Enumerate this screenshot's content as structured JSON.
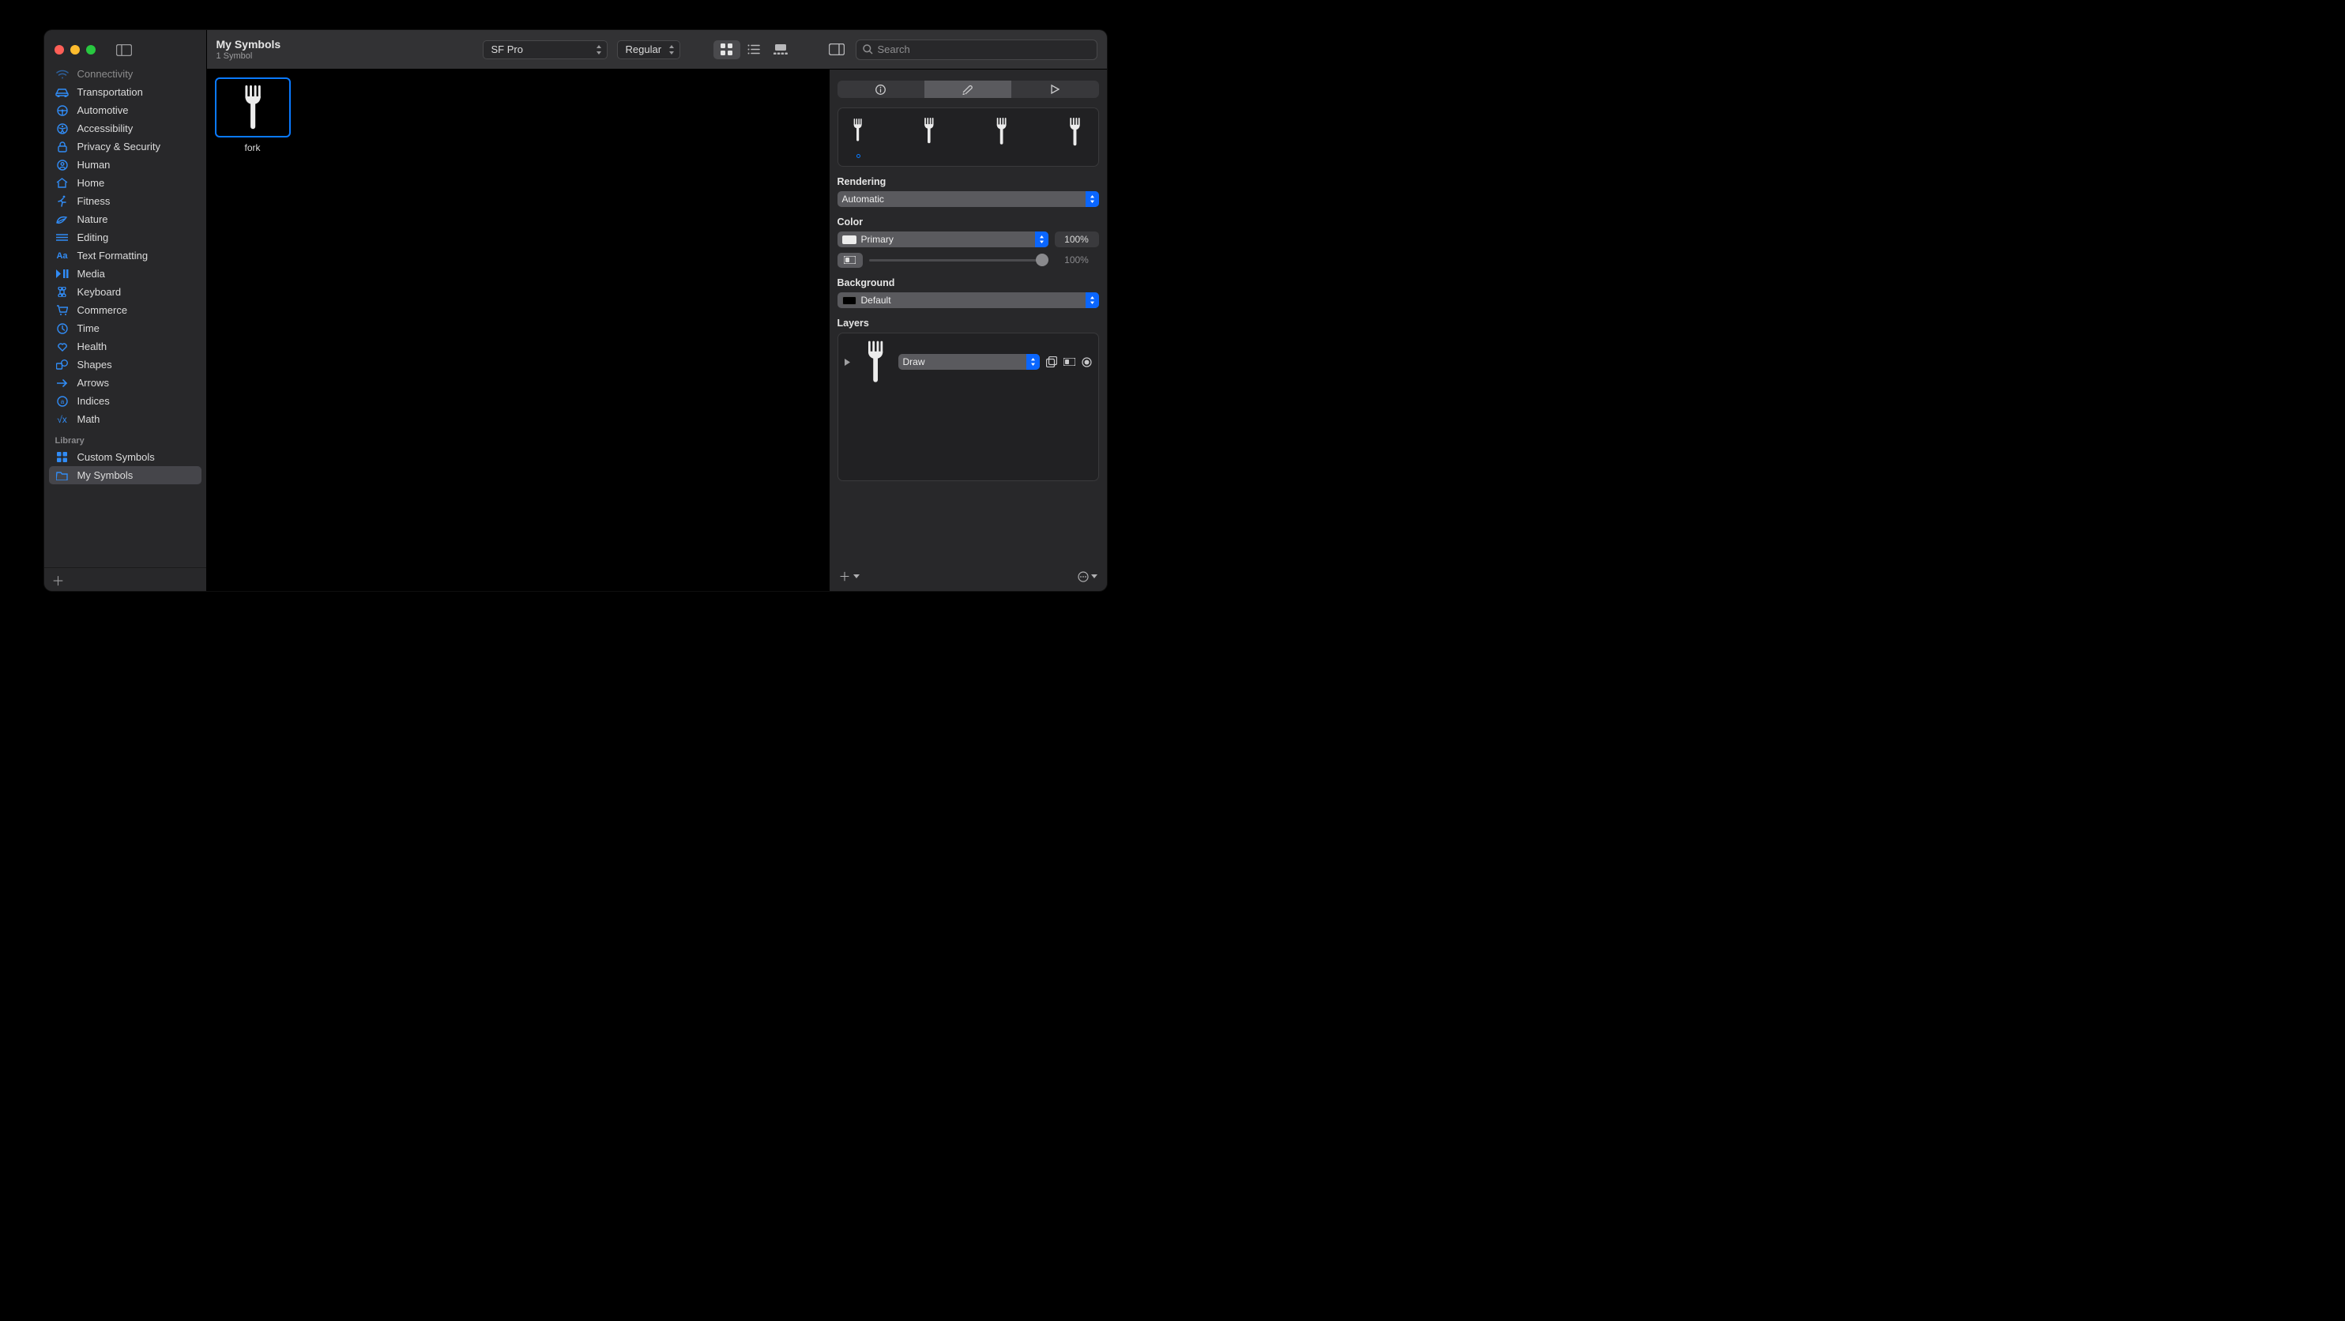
{
  "window": {
    "title": "My Symbols",
    "subtitle": "1 Symbol"
  },
  "toolbar": {
    "font": "SF Pro",
    "weight": "Regular",
    "search_placeholder": "Search"
  },
  "sidebar": {
    "categories": [
      {
        "label": "Connectivity",
        "icon": "wifi"
      },
      {
        "label": "Transportation",
        "icon": "car"
      },
      {
        "label": "Automotive",
        "icon": "steering"
      },
      {
        "label": "Accessibility",
        "icon": "accessibility"
      },
      {
        "label": "Privacy & Security",
        "icon": "lock"
      },
      {
        "label": "Human",
        "icon": "person"
      },
      {
        "label": "Home",
        "icon": "house"
      },
      {
        "label": "Fitness",
        "icon": "runner"
      },
      {
        "label": "Nature",
        "icon": "leaf"
      },
      {
        "label": "Editing",
        "icon": "sliders"
      },
      {
        "label": "Text Formatting",
        "icon": "aa"
      },
      {
        "label": "Media",
        "icon": "playpause"
      },
      {
        "label": "Keyboard",
        "icon": "command"
      },
      {
        "label": "Commerce",
        "icon": "cart"
      },
      {
        "label": "Time",
        "icon": "clock"
      },
      {
        "label": "Health",
        "icon": "heart"
      },
      {
        "label": "Shapes",
        "icon": "shapes"
      },
      {
        "label": "Arrows",
        "icon": "arrow"
      },
      {
        "label": "Indices",
        "icon": "indices"
      },
      {
        "label": "Math",
        "icon": "math"
      }
    ],
    "library_label": "Library",
    "library": [
      {
        "label": "Custom Symbols",
        "icon": "grid",
        "active": false
      },
      {
        "label": "My Symbols",
        "icon": "folder",
        "active": true
      }
    ]
  },
  "gallery": {
    "items": [
      {
        "name": "fork"
      }
    ]
  },
  "inspector": {
    "rendering_label": "Rendering",
    "rendering_value": "Automatic",
    "color_label": "Color",
    "color_value": "Primary",
    "color_pct": "100%",
    "opacity_pct": "100%",
    "background_label": "Background",
    "background_value": "Default",
    "layers_label": "Layers",
    "layer_mode": "Draw"
  }
}
